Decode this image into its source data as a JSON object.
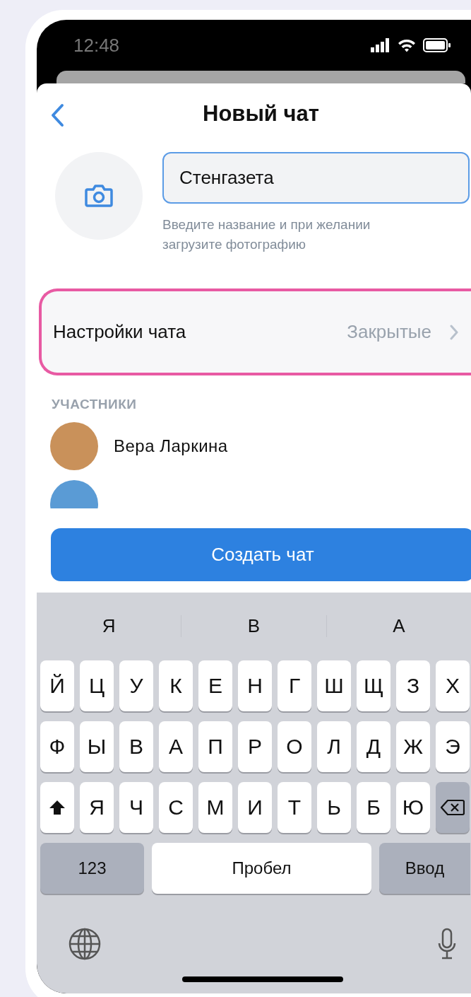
{
  "status_bar": {
    "time": "12:48"
  },
  "header": {
    "title": "Новый чат"
  },
  "chat_name_field": {
    "value": "Стенгазета",
    "hint": "Введите название и при желании загрузите фотографию"
  },
  "chat_settings": {
    "label": "Настройки чата",
    "value": "Закрытые"
  },
  "participants": {
    "header": "УЧАСТНИКИ",
    "items": [
      {
        "kind": "contact",
        "name": "Вера Ларкина"
      },
      {
        "kind": "cut_off"
      }
    ]
  },
  "create_button": {
    "label": "Создать чат"
  },
  "keyboard": {
    "suggestions": [
      "Я",
      "В",
      "А"
    ],
    "rows": [
      [
        {
          "kind": "letter",
          "label": "Й"
        },
        {
          "kind": "letter",
          "label": "Ц"
        },
        {
          "kind": "letter",
          "label": "У"
        },
        {
          "kind": "letter",
          "label": "К"
        },
        {
          "kind": "letter",
          "label": "Е"
        },
        {
          "kind": "letter",
          "label": "Н"
        },
        {
          "kind": "letter",
          "label": "Г"
        },
        {
          "kind": "letter",
          "label": "Ш"
        },
        {
          "kind": "letter",
          "label": "Щ"
        },
        {
          "kind": "letter",
          "label": "З"
        },
        {
          "kind": "letter",
          "label": "Х"
        }
      ],
      [
        {
          "kind": "letter",
          "label": "Ф"
        },
        {
          "kind": "letter",
          "label": "Ы"
        },
        {
          "kind": "letter",
          "label": "В"
        },
        {
          "kind": "letter",
          "label": "А"
        },
        {
          "kind": "letter",
          "label": "П"
        },
        {
          "kind": "letter",
          "label": "Р"
        },
        {
          "kind": "letter",
          "label": "О"
        },
        {
          "kind": "letter",
          "label": "Л"
        },
        {
          "kind": "letter",
          "label": "Д"
        },
        {
          "kind": "letter",
          "label": "Ж"
        },
        {
          "kind": "letter",
          "label": "Э"
        }
      ],
      [
        {
          "kind": "shift"
        },
        {
          "kind": "letter",
          "label": "Я"
        },
        {
          "kind": "letter",
          "label": "Ч"
        },
        {
          "kind": "letter",
          "label": "С"
        },
        {
          "kind": "letter",
          "label": "М"
        },
        {
          "kind": "letter",
          "label": "И"
        },
        {
          "kind": "letter",
          "label": "Т"
        },
        {
          "kind": "letter",
          "label": "Ь"
        },
        {
          "kind": "letter",
          "label": "Б"
        },
        {
          "kind": "letter",
          "label": "Ю"
        },
        {
          "kind": "backspace"
        }
      ]
    ],
    "bottom_row": [
      {
        "kind": "numbers",
        "label": "123"
      },
      {
        "kind": "space",
        "label": "Пробел"
      },
      {
        "kind": "return",
        "label": "Ввод"
      }
    ]
  }
}
